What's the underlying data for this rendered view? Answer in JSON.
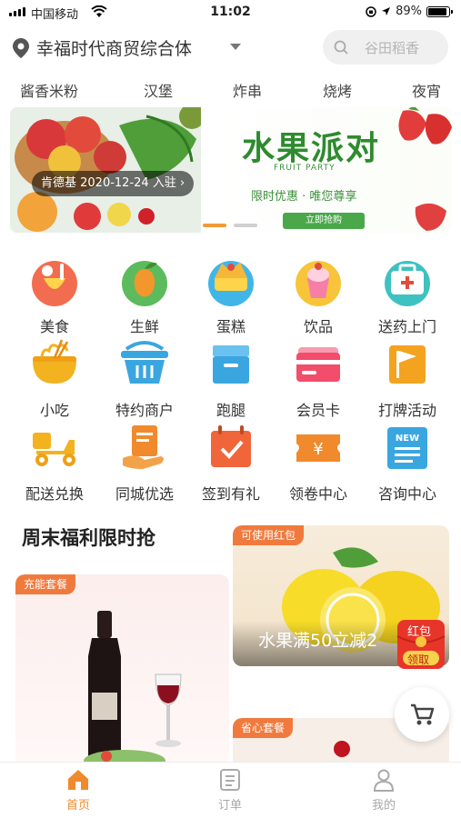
{
  "status_bar": {
    "carrier": "中国移动",
    "time": "11:02",
    "battery": "89%",
    "battery_level": 0.89
  },
  "header": {
    "location": "幸福时代商贸综合体",
    "search_placeholder": "谷田稻香"
  },
  "categories": [
    "酱香米粉",
    "汉堡",
    "炸串",
    "烧烤",
    "夜宵"
  ],
  "banner": {
    "merchant_badge": "肯德基 2020-12-24 入驻 ›",
    "title": "水果派对",
    "subtitle": "FRUIT PARTY",
    "slogan": "限时优惠 · 唯您尊享",
    "cta": "立即抢购",
    "active_slide": 1,
    "slide_count": 2
  },
  "grid": [
    {
      "label": "美食",
      "icon": "food-icon",
      "color": "#f26d4f"
    },
    {
      "label": "生鲜",
      "icon": "fresh-produce-icon",
      "color": "#5cbb5c"
    },
    {
      "label": "蛋糕",
      "icon": "cake-icon",
      "color": "#42b5e8"
    },
    {
      "label": "饮品",
      "icon": "drink-icon",
      "color": "#f7c43a"
    },
    {
      "label": "送药上门",
      "icon": "medicine-icon",
      "color": "#3ec1c1"
    },
    {
      "label": "小吃",
      "icon": "noodles-icon",
      "color": "#f3b21f"
    },
    {
      "label": "特约商户",
      "icon": "basket-icon",
      "color": "#3aa6e0"
    },
    {
      "label": "跑腿",
      "icon": "box-icon",
      "color": "#3aa6e0"
    },
    {
      "label": "会员卡",
      "icon": "member-card-icon",
      "color": "#f24d6a"
    },
    {
      "label": "打牌活动",
      "icon": "flag-icon",
      "color": "#f3a31f"
    },
    {
      "label": "配送兑换",
      "icon": "scooter-icon",
      "color": "#f3b21f"
    },
    {
      "label": "同城优选",
      "icon": "document-hand-icon",
      "color": "#f08a2c"
    },
    {
      "label": "签到有礼",
      "icon": "calendar-check-icon",
      "color": "#f0653a"
    },
    {
      "label": "领卷中心",
      "icon": "coupon-icon",
      "color": "#f08a2c"
    },
    {
      "label": "咨询中心",
      "icon": "news-icon",
      "color": "#3aa6e0"
    }
  ],
  "promo": {
    "section_title": "周末福利限时抢",
    "card_a_tag": "充能套餐",
    "card_b_tag": "可使用红包",
    "card_b_caption": "水果满50立减2",
    "card_c_tag": "省心套餐",
    "red_packet_top": "红包",
    "red_packet_bottom": "领取"
  },
  "bottom_nav": [
    {
      "label": "首页",
      "icon": "home-icon",
      "active": true
    },
    {
      "label": "订单",
      "icon": "order-icon",
      "active": false
    },
    {
      "label": "我的",
      "icon": "profile-icon",
      "active": false
    }
  ],
  "colors": {
    "accent": "#f08a2c",
    "banner_green": "#2e8b2e",
    "tag_orange": "#f07a3e"
  }
}
